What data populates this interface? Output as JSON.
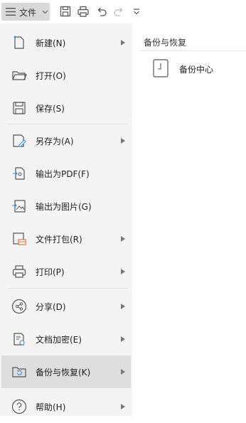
{
  "toolbar": {
    "file_label": "文件",
    "icons": [
      "menu-icon",
      "save-icon",
      "print-icon",
      "undo-icon",
      "redo-icon",
      "customize-icon"
    ]
  },
  "menu": {
    "items": [
      {
        "label": "新建(N)",
        "icon": "new-file-icon",
        "has_submenu": true
      },
      {
        "label": "打开(O)",
        "icon": "open-folder-icon",
        "has_submenu": false
      },
      {
        "label": "保存(S)",
        "icon": "save-icon",
        "has_submenu": false
      },
      {
        "label": "另存为(A)",
        "icon": "save-as-icon",
        "has_submenu": true
      },
      {
        "label": "输出为PDF(F)",
        "icon": "export-pdf-icon",
        "has_submenu": false
      },
      {
        "label": "输出为图片(G)",
        "icon": "export-image-icon",
        "has_submenu": false
      },
      {
        "label": "文件打包(R)",
        "icon": "package-icon",
        "has_submenu": true
      },
      {
        "label": "打印(P)",
        "icon": "print-icon",
        "has_submenu": true
      },
      {
        "label": "分享(D)",
        "icon": "share-icon",
        "has_submenu": true
      },
      {
        "label": "文档加密(E)",
        "icon": "encrypt-icon",
        "has_submenu": true
      },
      {
        "label": "备份与恢复(K)",
        "icon": "backup-restore-icon",
        "has_submenu": true,
        "active": true
      },
      {
        "label": "帮助(H)",
        "icon": "help-icon",
        "has_submenu": true
      }
    ]
  },
  "panel": {
    "title": "备份与恢复",
    "items": [
      {
        "label": "备份中心",
        "icon": "backup-center-icon"
      }
    ]
  },
  "colors": {
    "menu_bg": "#f4f4f4",
    "active_bg": "#dedede",
    "file_button_bg": "#d9d9d9",
    "icon_stroke": "#555555"
  }
}
